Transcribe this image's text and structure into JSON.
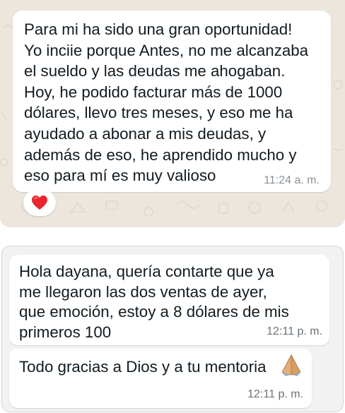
{
  "top_chat": {
    "message": {
      "text": "Para mi ha sido una gran oportunidad!\nYo inciie porque Antes, no me alcanzaba\nel sueldo y las deudas me ahogaban.\nHoy, he podido facturar más de 1000\ndólares, llevo tres meses, y eso me ha\nayudado a abonar a mis  deudas, y\nademás de eso, he aprendido mucho y\neso para mí es muy valioso",
      "time": "11:24 a. m."
    },
    "reaction": {
      "icon": "red-heart-icon",
      "color": "#e8242f"
    },
    "background_color": "#ece6dc"
  },
  "bottom_chat": {
    "messages": [
      {
        "text": "Hola dayana, quería contarte que ya\nme llegaron las dos ventas de ayer,\nque emoción, estoy a 8 dólares de mis\nprimeros 100",
        "time": "12:11 p. m."
      },
      {
        "text": "Todo gracias a Dios y a tu mentoria",
        "emoji_icon": "folded-hands-icon",
        "time": "12:11 p. m."
      }
    ],
    "background_color": "#f2f2f2"
  }
}
